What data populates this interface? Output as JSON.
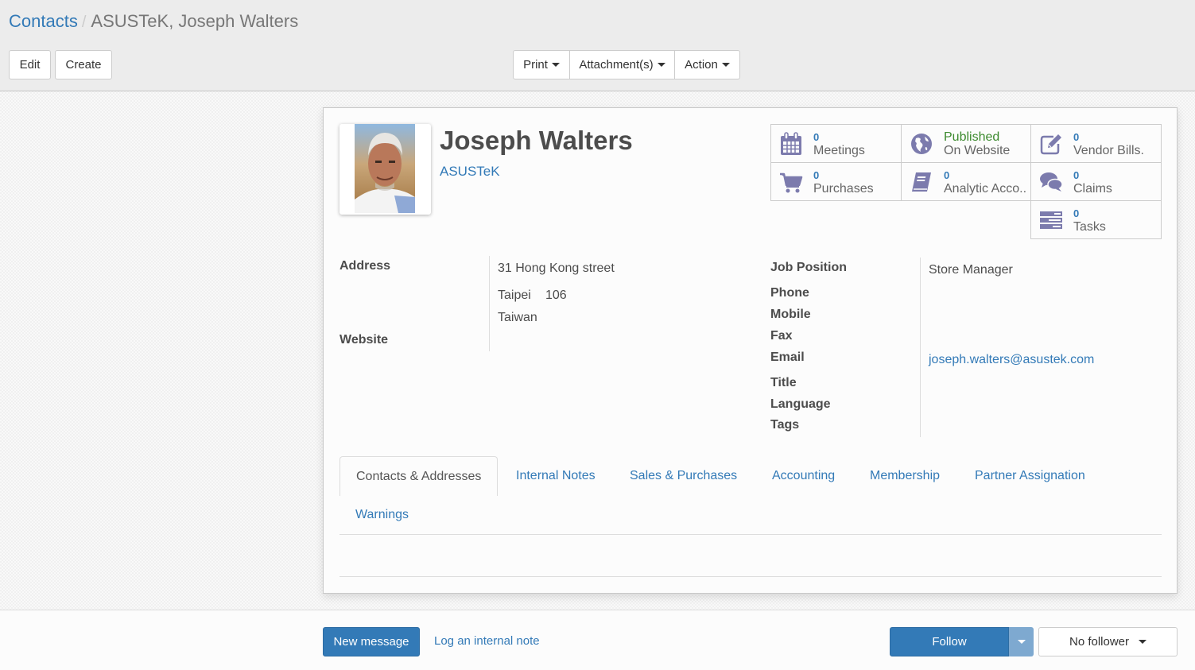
{
  "breadcrumb": {
    "parent": "Contacts",
    "separator": "/",
    "current": "ASUSTeK, Joseph Walters"
  },
  "toolbar": {
    "edit_label": "Edit",
    "create_label": "Create",
    "print_label": "Print",
    "attachments_label": "Attachment(s)",
    "action_label": "Action"
  },
  "partner": {
    "name": "Joseph Walters",
    "company": "ASUSTeK"
  },
  "smart_buttons": [
    {
      "icon": "calendar-icon",
      "value": "0",
      "label": "Meetings"
    },
    {
      "icon": "globe-icon",
      "value": "Published",
      "label": "On Website"
    },
    {
      "icon": "edit-icon",
      "value": "0",
      "label": "Vendor Bills."
    },
    {
      "icon": "shopping-cart-icon",
      "value": "0",
      "label": "Purchases"
    },
    {
      "icon": "book-icon",
      "value": "0",
      "label": "Analytic Acco.."
    },
    {
      "icon": "comments-icon",
      "value": "0",
      "label": "Claims"
    },
    {
      "icon": "tasks-icon",
      "value": "0",
      "label": "Tasks"
    }
  ],
  "fields": {
    "address_label": "Address",
    "street": "31 Hong Kong street",
    "city": "Taipei",
    "zip": "106",
    "country": "Taiwan",
    "website_label": "Website",
    "job_position_label": "Job Position",
    "job_position": "Store Manager",
    "phone_label": "Phone",
    "mobile_label": "Mobile",
    "fax_label": "Fax",
    "email_label": "Email",
    "email": "joseph.walters@asustek.com",
    "title_label": "Title",
    "language_label": "Language",
    "tags_label": "Tags"
  },
  "tabs": [
    {
      "label": "Contacts & Addresses",
      "active": true
    },
    {
      "label": "Internal Notes",
      "active": false
    },
    {
      "label": "Sales & Purchases",
      "active": false
    },
    {
      "label": "Accounting",
      "active": false
    },
    {
      "label": "Membership",
      "active": false
    },
    {
      "label": "Partner Assignation",
      "active": false
    },
    {
      "label": "Warnings",
      "active": false
    }
  ],
  "chatter": {
    "new_message_label": "New message",
    "log_note_label": "Log an internal note",
    "follow_label": "Follow",
    "followers_label": "No follower"
  },
  "colors": {
    "link": "#337ab7",
    "primary": "#337ab7",
    "icon": "#7c7bad",
    "published": "#3c8a2e"
  }
}
